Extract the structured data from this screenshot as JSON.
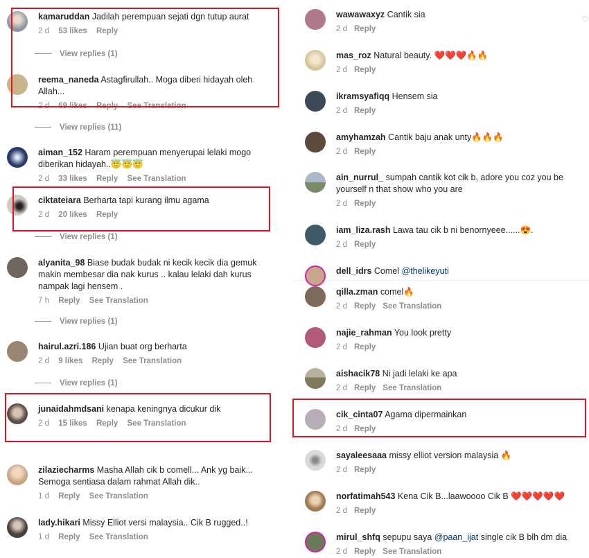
{
  "left": {
    "comments": [
      {
        "user": "kamaruddan",
        "text": "Jadilah perempuan sejati dgn tutup aurat",
        "meta": [
          "2 d",
          "53 likes",
          "Reply"
        ],
        "replies": "View replies (1)",
        "avatar": "#8b96a6"
      },
      {
        "user": "reema_naneda",
        "text": "Astagfirullah.. Moga diberi hidayah oleh Allah...",
        "meta": [
          "2 d",
          "69 likes",
          "Reply",
          "See Translation"
        ],
        "replies": "View replies (11)",
        "avatar": "#c9b48e"
      },
      {
        "user": "aiman_152",
        "text": "Haram perempuan menyerupai lelaki mogo diberikan hidayah..😇😇😇",
        "meta": [
          "2 d",
          "33 likes",
          "Reply",
          "See Translation"
        ],
        "replies": "",
        "avatar": "#2a3a6a"
      },
      {
        "user": "ciktateiara",
        "text": "Berharta tapi kurang ilmu agama",
        "meta": [
          "2 d",
          "20 likes",
          "Reply"
        ],
        "replies": "View replies (1)",
        "avatar": "#cfc9c0"
      },
      {
        "user": "alyanita_98",
        "text": "Biase budak budak ni kecik kecik dia gemuk makin membesar dia nak kurus .. kalau lelaki dah kurus nampak lagi hensem .",
        "meta": [
          "7 h",
          "Reply",
          "See Translation"
        ],
        "replies": "View replies (1)",
        "avatar": "#6f6660"
      },
      {
        "user": "hairul.azri.186",
        "text": "Ujian buat org berharta",
        "meta": [
          "2 d",
          "9 likes",
          "Reply",
          "See Translation"
        ],
        "replies": "View replies (1)",
        "avatar": "#9a8670"
      },
      {
        "user": "junaidahmdsani",
        "text": "kenapa keningnya dicukur dik",
        "meta": [
          "2 d",
          "15 likes",
          "Reply",
          "See Translation"
        ],
        "replies": "",
        "avatar": "#5a4f4a"
      },
      {
        "user": "zilaziecharms",
        "text": "Masha Allah cik b comell... Ank yg baik... Semoga sentiasa dalam rahmat Allah dik..",
        "meta": [
          "1 d",
          "Reply",
          "See Translation"
        ],
        "replies": "",
        "avatar": "#c8a383"
      },
      {
        "user": "lady.hikari",
        "text": "Missy Elliot versi malaysia.. Cik B rugged..!",
        "meta": [
          "1 d",
          "Reply",
          "See Translation"
        ],
        "replies": "",
        "avatar": "#4a4040"
      }
    ]
  },
  "right": {
    "comments": [
      {
        "user": "wawawaxyz",
        "text": "Cantik sia",
        "meta": [
          "2 d",
          "Reply"
        ],
        "avatar": "#b07a8a"
      },
      {
        "user": "mas_roz",
        "text": "Natural beauty. ❤️❤️❤️🔥🔥",
        "meta": [
          "2 d",
          "Reply"
        ],
        "avatar": "#d6c49a"
      },
      {
        "user": "ikramsyafiqq",
        "text": "Hensem sia",
        "meta": [
          "2 d",
          "Reply"
        ],
        "avatar": "#3d4a55"
      },
      {
        "user": "amyhamzah",
        "text": "Cantik baju anak unty🔥🔥🔥",
        "meta": [
          "2 d",
          "Reply"
        ],
        "avatar": "#5b4a3c"
      },
      {
        "user": "ain_nurrul_",
        "text": "sumpah cantik kot cik b, adore you coz you be yourself n that show who you are",
        "meta": [
          "2 d",
          "Reply"
        ],
        "avatar": "#8fa0b3"
      },
      {
        "user": "iam_liza.rash",
        "text": "Lawa tau cik b ni benornyeee......😍.",
        "meta": [
          "2 d",
          "Reply"
        ],
        "avatar": "#3f5a66"
      },
      {
        "user": "dell_idrs",
        "text": "Comel",
        "mention": "@thelikeyuti",
        "meta": [],
        "avatar": "#c7a68c"
      },
      {
        "user": "qilla.zman",
        "text": "comel🔥",
        "meta": [
          "2 d",
          "Reply",
          "See Translation"
        ],
        "avatar": "#7d6a5a"
      },
      {
        "user": "najie_rahman",
        "text": "You look pretty",
        "meta": [
          "2 d",
          "Reply"
        ],
        "avatar": "#b35a7a"
      },
      {
        "user": "aishacik78",
        "text": "Ni jadi lelaki ke apa",
        "meta": [
          "2 d",
          "Reply",
          "See Translation"
        ],
        "avatar": "#7f7a5c"
      },
      {
        "user": "cik_cinta07",
        "text": "Agama dipermainkan",
        "meta": [
          "2 d",
          "Reply"
        ],
        "avatar": "#b8aeb8"
      },
      {
        "user": "sayaleesaaa",
        "text": "missy elliot version malaysia 🔥",
        "meta": [
          "2 d",
          "Reply"
        ],
        "avatar": "#d9d9d9"
      },
      {
        "user": "norfatimah543",
        "text": "Kena Cik B...laawoooo Cik B ❤️❤️❤️❤️❤️",
        "meta": [
          "2 d",
          "Reply"
        ],
        "avatar": "#a07a50"
      },
      {
        "user": "mirul_shfq",
        "text": "sepupu saya",
        "mention": "@paan_ijat",
        "text2": "single cik B blh dm dia",
        "meta": [
          "2 d",
          "Reply",
          "See Translation"
        ],
        "avatar": "#6a7a5a"
      }
    ]
  }
}
